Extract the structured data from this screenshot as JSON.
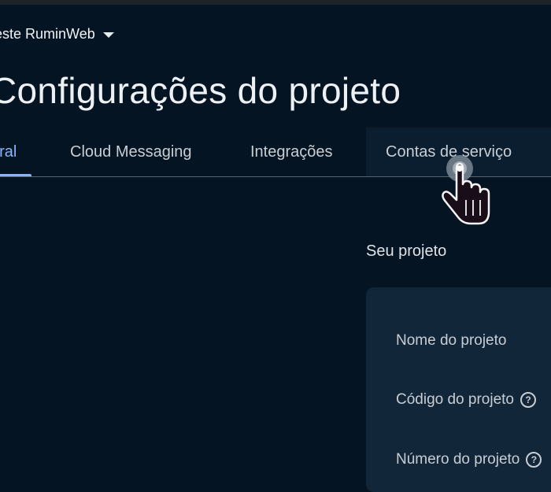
{
  "header": {
    "project_name": "este RuminWeb",
    "page_title": "Configurações do projeto"
  },
  "tabs": [
    {
      "label": "eral",
      "active": true
    },
    {
      "label": "Cloud Messaging",
      "active": false
    },
    {
      "label": "Integrações",
      "active": false
    },
    {
      "label": "Contas de serviço",
      "active": false,
      "hovered": true
    }
  ],
  "section": {
    "title": "Seu projeto"
  },
  "fields": [
    {
      "label": "Nome do projeto",
      "help": false
    },
    {
      "label": "Código do projeto",
      "help": true
    },
    {
      "label": "Número do projeto",
      "help": true
    }
  ],
  "icons": {
    "help": "?",
    "caret": "chevron-down-icon",
    "cursor": "hand-pointer-icon"
  },
  "colors": {
    "background": "#051423",
    "accent": "#8ab4f8",
    "card": "#12263a"
  }
}
